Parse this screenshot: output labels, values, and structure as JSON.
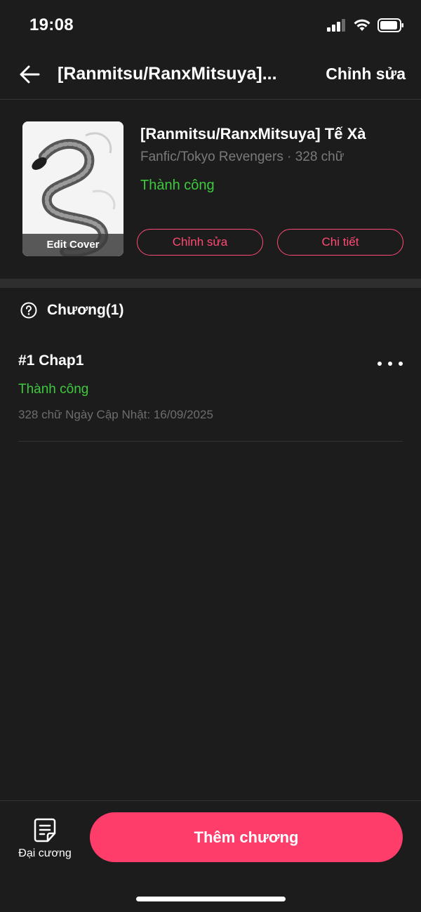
{
  "status_bar": {
    "time": "19:08"
  },
  "nav": {
    "title": "[Ranmitsu/RanxMitsuya]...",
    "edit_label": "Chỉnh sửa"
  },
  "story": {
    "cover_label": "Edit Cover",
    "title": "[Ranmitsu/RanxMitsuya] Tế Xà",
    "meta": "Fanfic/Tokyo Revengers · 328 chữ",
    "status": "Thành công",
    "edit_button": "Chỉnh sửa",
    "detail_button": "Chi tiết"
  },
  "chapters": {
    "header": "Chương(1)",
    "items": [
      {
        "name": "#1 Chap1",
        "status": "Thành công",
        "meta": "328 chữ Ngày Cập Nhật: 16/09/2025"
      }
    ]
  },
  "bottom": {
    "outline_label": "Đại cương",
    "add_chapter_label": "Thêm chương"
  },
  "colors": {
    "accent": "#ff3d6b",
    "success": "#3ec93e",
    "background": "#1c1c1c"
  },
  "icons": [
    "signal-icon",
    "wifi-icon",
    "battery-icon",
    "back-arrow-icon",
    "help-circle-icon",
    "more-dots-icon",
    "outline-document-icon"
  ]
}
